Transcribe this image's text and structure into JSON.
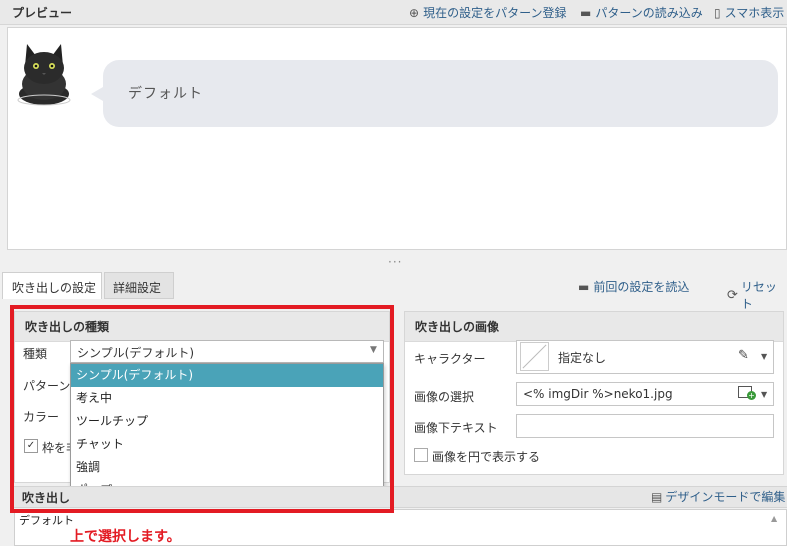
{
  "preview": {
    "title": "プレビュー",
    "register_pattern": "現在の設定をパターン登録",
    "load_pattern": "パターンの読み込み",
    "mobile_view": "スマホ表示",
    "bubble_text": "デフォルト"
  },
  "resize_grip": "···",
  "tabs": {
    "basic": "吹き出しの設定",
    "detail": "詳細設定",
    "load_last": "前回の設定を読込",
    "reset": "リセット"
  },
  "type_panel": {
    "title": "吹き出しの種類",
    "type_label": "種類",
    "pattern_label": "パターン",
    "color_label": "カラー",
    "frame_label": "枠を非",
    "selected_value": "シンプル(デフォルト)",
    "options": [
      "シンプル(デフォルト)",
      "考え中",
      "ツールチップ",
      "チャット",
      "強調",
      "ポップ"
    ],
    "selected_index": 0
  },
  "image_panel": {
    "title": "吹き出しの画像",
    "character_label": "キャラクター",
    "character_value": "指定なし",
    "image_select_label": "画像の選択",
    "image_select_value": "<% imgDir %>neko1.jpg",
    "caption_label": "画像下テキスト",
    "caption_value": "",
    "circle_label": "画像を円で表示する"
  },
  "text_section": {
    "title": "吹き出し",
    "design_mode": "デザインモードで編集",
    "value": "デフォルト"
  },
  "annotation": "上で選択します。",
  "colors": {
    "accent_blue": "#4aa3b8",
    "highlight_red": "#e31b23",
    "link": "#2f5f8a"
  }
}
